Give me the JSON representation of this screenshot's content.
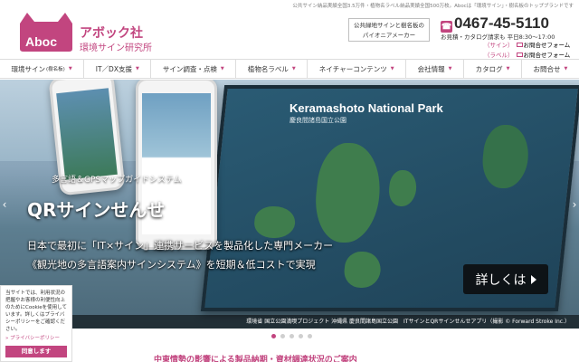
{
  "top_tagline": "公共サイン納品実績全国3.5万件・植物名ラベル納品実績全国500万枚。Abocは「環境サイン」・樹名板のトップブランドです",
  "logo": {
    "mark": "Aboc",
    "name": "アボック社",
    "sub": "環境サイン研究所"
  },
  "pioneer_box": {
    "line1": "公共緑地サインと樹名板の",
    "line2": "パイオニアメーカー"
  },
  "contact": {
    "phone": "0467-45-5110",
    "hours": "お見積・カタログ請求も 平日8:30〜17:00",
    "links": [
      {
        "prefix": "（サイン）",
        "label": "お問合せフォーム"
      },
      {
        "prefix": "（ラベル）",
        "label": "お問合せフォーム"
      }
    ]
  },
  "nav": [
    {
      "label": "環境サイン",
      "small": "(樹名板)"
    },
    {
      "label": "IT／DX支援",
      "small": ""
    },
    {
      "label": "サイン調査・点検",
      "small": ""
    },
    {
      "label": "植物名ラベル",
      "small": ""
    },
    {
      "label": "ネイチャーコンテンツ",
      "small": ""
    },
    {
      "label": "会社情報",
      "small": ""
    },
    {
      "label": "カタログ",
      "small": ""
    },
    {
      "label": "お問合せ",
      "small": ""
    }
  ],
  "hero": {
    "eyebrow": "多言語＆GPSマップガイドシステム",
    "app_name": "QRサインせんせ",
    "headline": "日本で最初に「IT×サイン」連携サービスを製品化した専門メーカー",
    "subheadline": "《観光地の多言語案内サインシステム》を短期＆低コストで実現",
    "details_button": "詳しくは",
    "board_title": "Keramashoto National Park",
    "board_subtitle": "慶良間諸島国立公園",
    "caption": "環境省 国立公園満喫プロジェクト 沖縄県 慶良間諸島国立公園　ITサインとQRサインせんせアプリ（撮影 © Forward Stroke Inc.）"
  },
  "slider": {
    "count": 5,
    "active": 0
  },
  "notice_banner": "中東情勢の影響による製品納期・資材調達状況のご案内",
  "cookie_banner": {
    "text": "当サイトでは、利用状況の把握やお客様の利便性向上のためにCookieを使用しています。詳しくはプライバシーポリシーをご確認ください。",
    "policy_link": "» プライバシーポリシー",
    "agree_button": "同意します"
  },
  "colors": {
    "brand": "#c2457f"
  }
}
